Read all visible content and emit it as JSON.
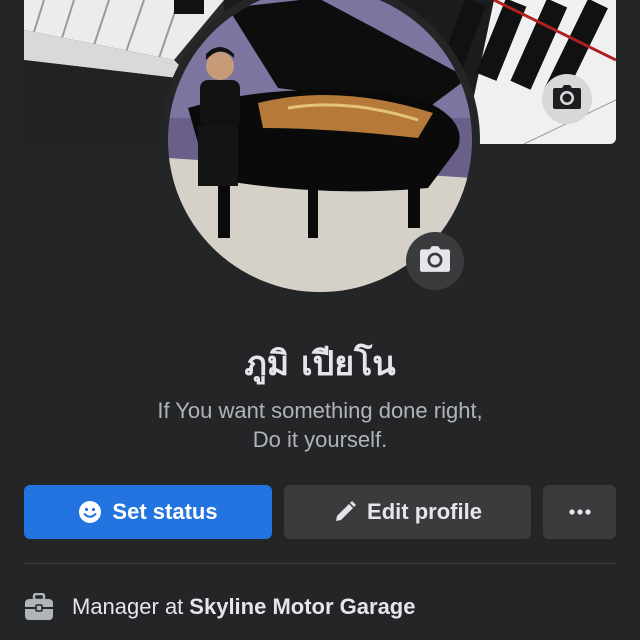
{
  "profile": {
    "name": "ภูมิ เปียโน",
    "bio_line1": "If You want something done right,",
    "bio_line2": "Do it yourself.",
    "cover_photo_icon": "camera-icon",
    "avatar_photo_icon": "camera-icon"
  },
  "actions": {
    "set_status_label": "Set status",
    "set_status_icon": "smiley-icon",
    "edit_profile_label": "Edit profile",
    "edit_profile_icon": "pencil-icon",
    "more_icon": "more-dots-icon"
  },
  "details": {
    "work_prefix": "Manager at",
    "work_place": "Skyline Motor Garage",
    "work_icon": "briefcase-icon"
  },
  "colors": {
    "background": "#242526",
    "primary_button": "#2374e1",
    "secondary_button": "#3a3b3c",
    "text_primary": "#e4e6eb",
    "text_secondary": "#b0b3b8"
  }
}
